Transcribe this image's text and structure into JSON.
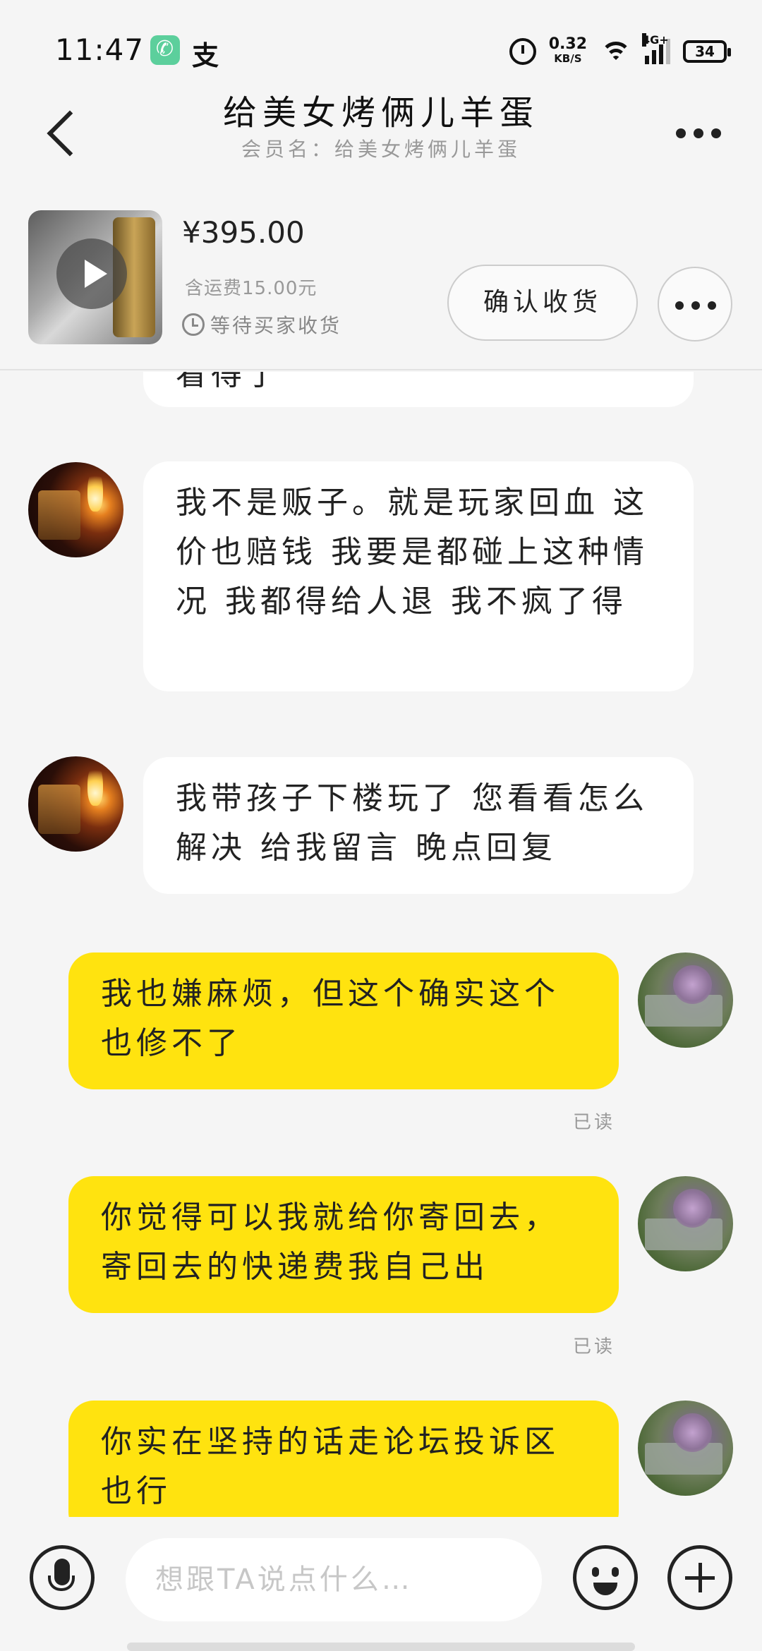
{
  "status_bar": {
    "time": "11:47",
    "app_icons": [
      "phone-icon",
      "alipay-icon"
    ],
    "alipay_glyph": "支",
    "net_speed": "0.32",
    "net_speed_unit": "KB/S",
    "network": "4G+",
    "battery": "34"
  },
  "header": {
    "title": "给美女烤俩儿羊蛋",
    "subtitle": "会员名：给美女烤俩儿羊蛋"
  },
  "product": {
    "price": "¥395.00",
    "shipping": "含运费15.00元",
    "status": "等待买家收货",
    "confirm_label": "确认收货"
  },
  "messages": [
    {
      "side": "in",
      "text": "看得了",
      "partial": true
    },
    {
      "side": "in",
      "text": "我不是贩子。就是玩家回血 这价也赔钱 我要是都碰上这种情况 我都得给人退 我不疯了得"
    },
    {
      "side": "in",
      "text": "我带孩子下楼玩了 您看看怎么解决 给我留言 晚点回复"
    },
    {
      "side": "out",
      "text": "我也嫌麻烦，但这个确实这个也修不了",
      "read": "已读"
    },
    {
      "side": "out",
      "text": "你觉得可以我就给你寄回去，寄回去的快递费我自己出",
      "read": "已读"
    },
    {
      "side": "out",
      "text": "你实在坚持的话走论坛投诉区也行"
    }
  ],
  "input": {
    "placeholder": "想跟TA说点什么…"
  },
  "colors": {
    "outgoing_bubble": "#ffe30f",
    "incoming_bubble": "#ffffff",
    "background": "#f5f5f5"
  }
}
